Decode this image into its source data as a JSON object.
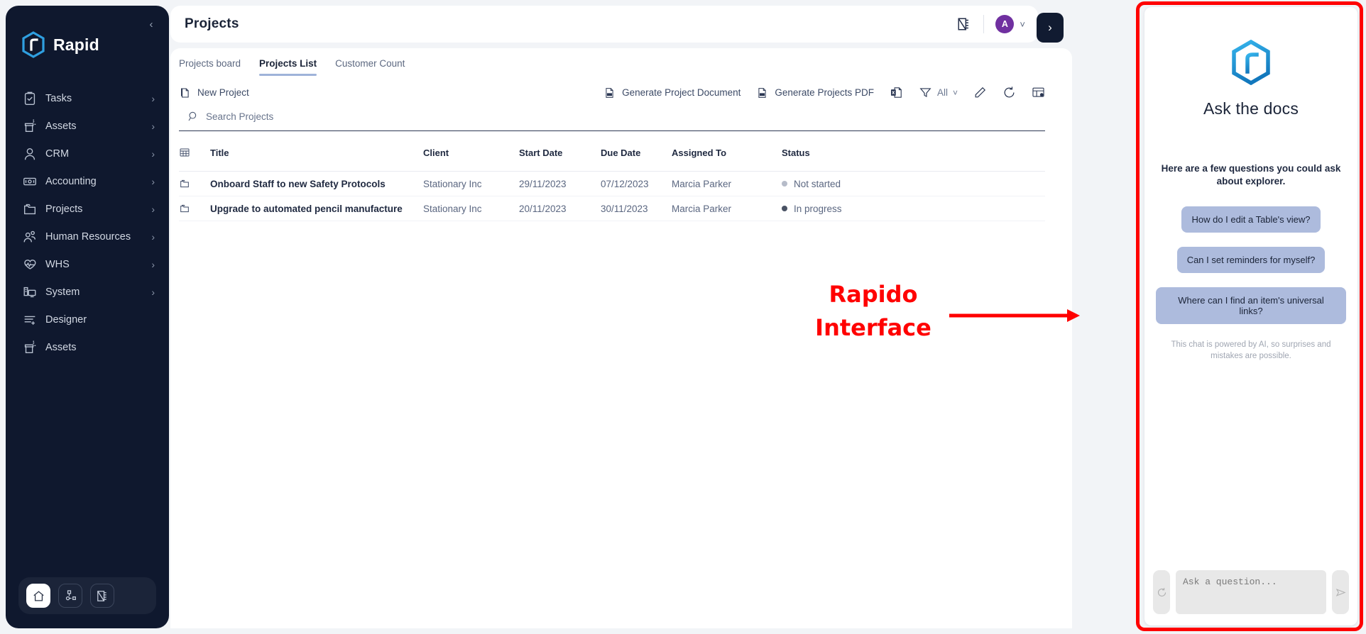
{
  "sidebar": {
    "brand": "Rapid",
    "collapse_icon": "chevron-left-icon",
    "items": [
      {
        "label": "Tasks",
        "icon": "clipboard-check-icon",
        "chevron": "›"
      },
      {
        "label": "Assets",
        "icon": "asset-box-icon",
        "chevron": "›"
      },
      {
        "label": "CRM",
        "icon": "person-icon",
        "chevron": "›"
      },
      {
        "label": "Accounting",
        "icon": "banknote-icon",
        "chevron": "›"
      },
      {
        "label": "Projects",
        "icon": "folders-icon",
        "chevron": "›"
      },
      {
        "label": "Human Resources",
        "icon": "people-icon",
        "chevron": "›"
      },
      {
        "label": "WHS",
        "icon": "heartbeat-icon",
        "chevron": "›"
      },
      {
        "label": "System",
        "icon": "desktop-icon",
        "chevron": "›"
      },
      {
        "label": "Designer",
        "icon": "list-plus-icon",
        "chevron": ""
      },
      {
        "label": "Assets",
        "icon": "asset-box-icon",
        "chevron": ""
      }
    ],
    "dock": [
      {
        "icon": "home-icon",
        "active": true
      },
      {
        "icon": "sitemap-icon",
        "active": false
      },
      {
        "icon": "ruler-pen-icon",
        "active": false
      }
    ]
  },
  "topbar": {
    "title": "Projects",
    "design_icon": "ruler-pen-icon",
    "avatar_initial": "A",
    "avatar_chevron": "chevron-down-icon",
    "expand_icon": "chevron-right-icon"
  },
  "tabs": [
    {
      "label": "Projects board",
      "active": false
    },
    {
      "label": "Projects List",
      "active": true
    },
    {
      "label": "Customer Count",
      "active": false
    }
  ],
  "toolbar": {
    "new_project": "New Project",
    "new_project_icon": "new-document-icon",
    "generate_project_document": "Generate Project Document",
    "generate_project_document_icon": "pdf-file-icon",
    "generate_projects_pdf": "Generate Projects PDF",
    "generate_projects_pdf_icon": "pdf-file-icon",
    "excel_icon": "excel-export-icon",
    "filter_icon": "funnel-icon",
    "filter_label": "All",
    "filter_chevron": "chevron-down-icon",
    "edit_icon": "pencil-icon",
    "refresh_icon": "refresh-icon",
    "table_settings_icon": "table-settings-icon"
  },
  "search": {
    "placeholder": "Search Projects",
    "value": "",
    "icon": "search-icon"
  },
  "table": {
    "row_icon": "folder-icon",
    "header_icon": "grid-icon",
    "columns": [
      "Title",
      "Client",
      "Start Date",
      "Due Date",
      "Assigned To",
      "Status"
    ],
    "rows": [
      {
        "title": "Onboard Staff to new Safety Protocols",
        "client": "Stationary Inc",
        "start_date": "29/11/2023",
        "due_date": "07/12/2023",
        "assigned_to": "Marcia Parker",
        "status": "Not started",
        "status_color": "#b6bcc9"
      },
      {
        "title": "Upgrade to automated pencil manufacture",
        "client": "Stationary Inc",
        "start_date": "20/11/2023",
        "due_date": "30/11/2023",
        "assigned_to": "Marcia Parker",
        "status": "In progress",
        "status_color": "#4a5364"
      }
    ]
  },
  "chat": {
    "logo_icon": "rapid-hexagon-logo-icon",
    "heading": "Ask the docs",
    "subheading": "Here are a few questions you could ask about explorer.",
    "suggestions": [
      "How do I edit a Table's view?",
      "Can I set reminders for myself?",
      "Where can I find an item's universal links?"
    ],
    "disclaimer": "This chat is powered by AI, so surprises and mistakes are possible.",
    "reset_icon": "refresh-icon",
    "send_icon": "send-icon",
    "input_placeholder": "Ask a question...",
    "input_value": ""
  },
  "annotation": {
    "line1": "Rapido",
    "line2": "Interface",
    "color": "#ff0000",
    "arrow_icon": "arrow-right-icon"
  }
}
